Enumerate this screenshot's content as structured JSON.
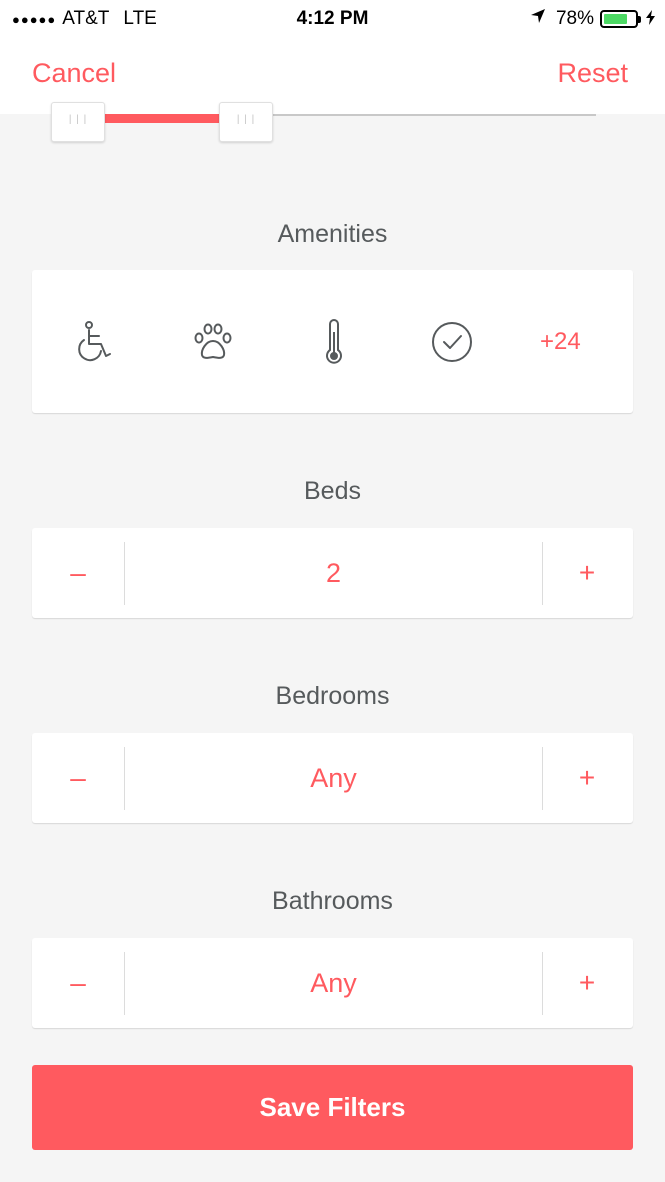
{
  "status_bar": {
    "carrier": "AT&T",
    "network": "LTE",
    "time": "4:12 PM",
    "battery": "78%",
    "battery_level": 0.78,
    "location_icon": "location-arrow-icon",
    "charging_icon": "bolt-icon"
  },
  "nav": {
    "cancel_label": "Cancel",
    "reset_label": "Reset"
  },
  "price_slider": {
    "handle_icon": "grip-icon"
  },
  "amenities": {
    "title": "Amenities",
    "icons": [
      "wheelchair-icon",
      "paw-icon",
      "thermometer-icon",
      "check-circle-icon"
    ],
    "more_label": "+24"
  },
  "beds": {
    "title": "Beds",
    "value": "2",
    "minus": "–",
    "plus": "+"
  },
  "bedrooms": {
    "title": "Bedrooms",
    "value": "Any",
    "minus": "–",
    "plus": "+"
  },
  "bathrooms": {
    "title": "Bathrooms",
    "value": "Any",
    "minus": "–",
    "plus": "+"
  },
  "save_label": "Save Filters",
  "colors": {
    "accent": "#ff5a5f",
    "text": "#565a5c",
    "background": "#f5f5f5",
    "battery": "#4cd964"
  }
}
